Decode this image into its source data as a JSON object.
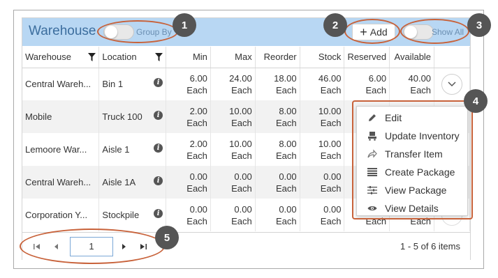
{
  "grid": {
    "title": "Warehouse",
    "group_by_label": "Group By",
    "add_label": "Add",
    "show_all_label": "Show All",
    "columns": [
      "Warehouse",
      "Location",
      "Min",
      "Max",
      "Reorder",
      "Stock",
      "Reserved",
      "Available"
    ],
    "rows": [
      {
        "warehouse": "Central Wareh...",
        "location": "Bin 1",
        "min": "6.00",
        "max": "24.00",
        "reorder": "18.00",
        "stock": "46.00",
        "reserved": "6.00",
        "available": "40.00",
        "unit": "Each"
      },
      {
        "warehouse": "Mobile",
        "location": "Truck 100",
        "min": "2.00",
        "max": "10.00",
        "reorder": "8.00",
        "stock": "10.00",
        "reserved": "",
        "available": "",
        "unit": "Each"
      },
      {
        "warehouse": "Lemoore War...",
        "location": "Aisle 1",
        "min": "2.00",
        "max": "10.00",
        "reorder": "8.00",
        "stock": "10.00",
        "reserved": "",
        "available": "",
        "unit": "Each"
      },
      {
        "warehouse": "Central Wareh...",
        "location": "Aisle 1A",
        "min": "0.00",
        "max": "0.00",
        "reorder": "0.00",
        "stock": "0.00",
        "reserved": "",
        "available": "",
        "unit": "Each"
      },
      {
        "warehouse": "Corporation Y...",
        "location": "Stockpile",
        "min": "0.00",
        "max": "0.00",
        "reorder": "0.00",
        "stock": "0.00",
        "reserved": "",
        "available": "",
        "unit": "Each"
      }
    ]
  },
  "menu": {
    "items": [
      "Edit",
      "Update Inventory",
      "Transfer Item",
      "Create Package",
      "View Package",
      "View Details"
    ]
  },
  "pager": {
    "current_page": "1",
    "info": "1 - 5 of 6 items"
  },
  "callouts": [
    "1",
    "2",
    "3",
    "4",
    "5"
  ],
  "colors": {
    "titlebar": "#b8d7f3",
    "title_text": "#3c6e9e",
    "callout_outline": "#c8623a",
    "badge": "#555555"
  }
}
